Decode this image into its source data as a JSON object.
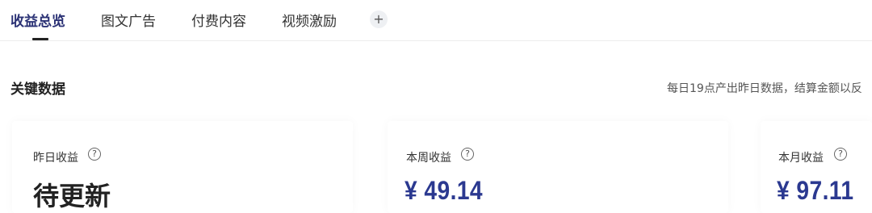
{
  "tabs": [
    {
      "label": "收益总览",
      "active": true
    },
    {
      "label": "图文广告",
      "active": false
    },
    {
      "label": "付费内容",
      "active": false
    },
    {
      "label": "视频激励",
      "active": false
    }
  ],
  "add_tab_symbol": "+",
  "section": {
    "title": "关键数据",
    "note": "每日19点产出昨日数据，结算金额以反"
  },
  "cards": [
    {
      "label": "昨日收益",
      "value": "待更新",
      "help": "?"
    },
    {
      "label": "本周收益",
      "value": "¥ 49.14",
      "help": "?"
    },
    {
      "label": "本月收益",
      "value": "¥ 97.11",
      "help": "?"
    }
  ],
  "colors": {
    "accent": "#2b3275",
    "money": "#2b3990"
  }
}
